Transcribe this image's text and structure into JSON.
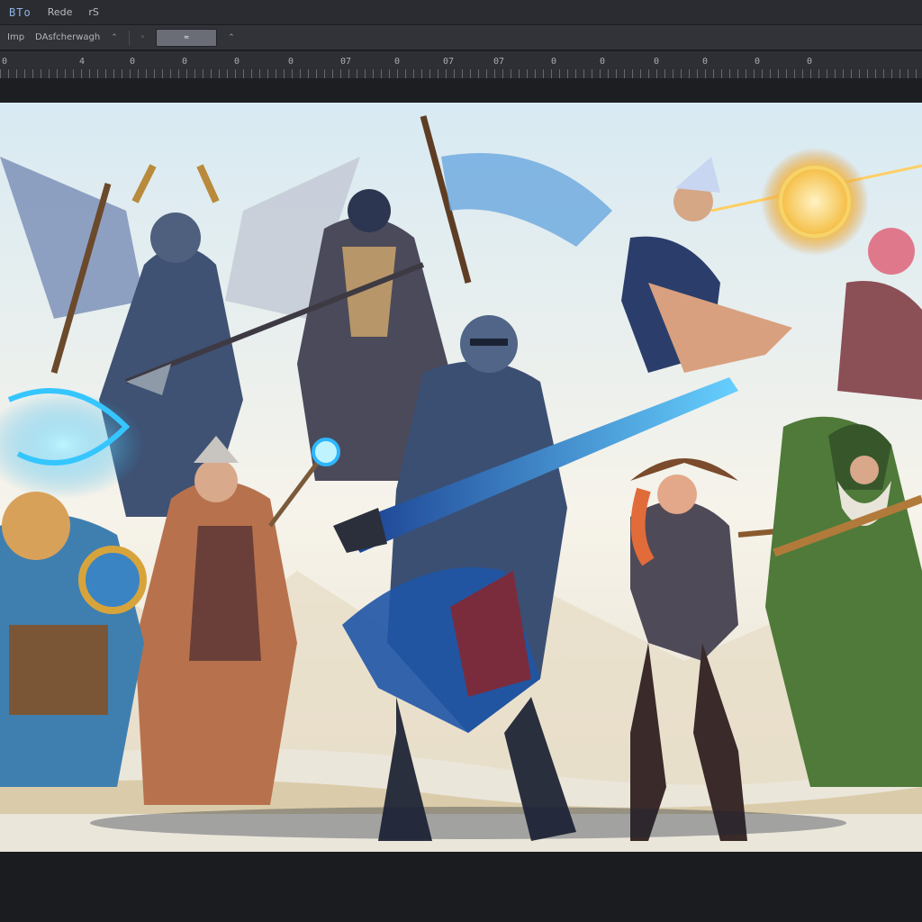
{
  "menubar": {
    "logo": "BTo",
    "items": [
      "Rede",
      "rS"
    ]
  },
  "options": {
    "label_1": "Imp",
    "label_2": "DAsfcherwagh",
    "caret": "⌃",
    "field_value": "≈",
    "field_icon": "⌃"
  },
  "ruler": {
    "labels": [
      "0",
      "4",
      "0",
      "0",
      "0",
      "0",
      "07",
      "0",
      "07",
      "07",
      "0",
      "0",
      "0",
      "0",
      "0",
      "0"
    ]
  },
  "canvas": {
    "artwork": "fantasy-heroes-illustration"
  },
  "colors": {
    "chrome_dark": "#1e1f23",
    "menubar": "#2b2c31",
    "optionsbar": "#323338",
    "sky": "#dfeef5",
    "sword_glow": "#3aa0ff",
    "portal_gold": "#f2b43a"
  }
}
